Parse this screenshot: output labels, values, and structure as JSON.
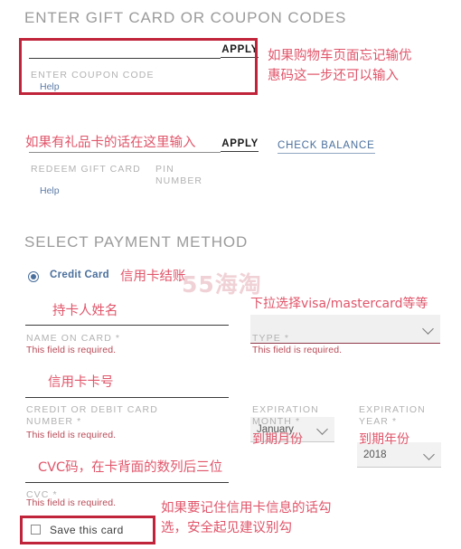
{
  "giftcard_section": {
    "heading": "ENTER GIFT CARD OR COUPON CODES",
    "coupon": {
      "input_value": "",
      "label": "ENTER COUPON CODE",
      "help_label": "Help",
      "apply_label": "APPLY"
    },
    "redeem": {
      "input_value": "",
      "label": "REDEEM GIFT CARD",
      "pin_label": "PIN\nNUMBER",
      "pin_value": "",
      "help_label": "Help",
      "apply_label": "APPLY",
      "check_balance_label": "CHECK BALANCE"
    }
  },
  "payment_section": {
    "heading": "SELECT PAYMENT METHOD",
    "method": {
      "credit_card_label": "Credit Card",
      "selected": true
    },
    "fields": {
      "name_on_card": {
        "value": "",
        "label": "NAME ON CARD *",
        "error": "This field is required."
      },
      "type": {
        "value": "",
        "label": "TYPE *",
        "error": "This field is required.",
        "chevron_icon": "chevron-down-icon"
      },
      "card_number": {
        "value": "",
        "label": "CREDIT OR DEBIT CARD\nNUMBER *",
        "error": "This field is required."
      },
      "expiration_month": {
        "value": "January",
        "label": "EXPIRATION\nMONTH *",
        "chevron_icon": "chevron-down-icon"
      },
      "expiration_year": {
        "value": "2018",
        "label": "EXPIRATION\nYEAR *",
        "chevron_icon": "chevron-down-icon"
      },
      "cvc": {
        "value": "",
        "label": "CVC *",
        "error": "This field is required."
      },
      "save_card": {
        "label": "Save this card",
        "checked": false
      }
    }
  },
  "annotations": {
    "coupon_note": "如果购物车页面忘记输优\n惠码这一步还可以输入",
    "giftcard_note": "如果有礼品卡的话在这里输入",
    "credit_card_note": "信用卡结账",
    "type_note": "下拉选择visa/mastercard等等",
    "name_note": "持卡人姓名",
    "card_number_note": "信用卡卡号",
    "exp_month_note": "到期月份",
    "exp_year_note": "到期年份",
    "cvc_note": "CVC码，在卡背面的数列后三位",
    "save_card_note": "如果要记住信用卡信息的话勾\n选，安全起见建议别勾"
  },
  "watermark": {
    "text": "55海淘"
  },
  "colors": {
    "annotation_red": "#e0556a",
    "box_red": "#c0243a",
    "link_blue": "#4a6f9c",
    "label_grey": "#b2b2b2",
    "error_red": "#b94a56"
  }
}
